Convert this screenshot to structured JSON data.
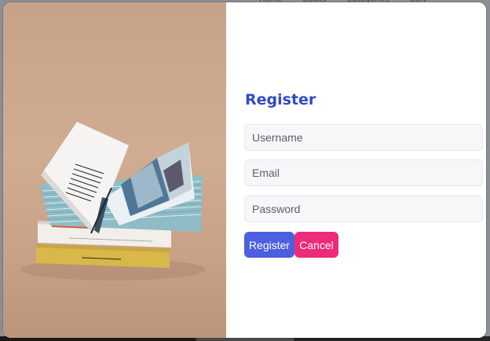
{
  "background_nav": {
    "items": [
      "Home",
      "Books",
      "Categories",
      "Cart"
    ]
  },
  "modal": {
    "image": {
      "icon": "open-book-stack-photo"
    },
    "form": {
      "title": "Register",
      "username": {
        "value": "",
        "placeholder": "Username"
      },
      "email": {
        "value": "",
        "placeholder": "Email"
      },
      "password": {
        "value": "",
        "placeholder": "Password"
      },
      "register_label": "Register",
      "cancel_label": "Cancel"
    }
  },
  "colors": {
    "title": "#2f49c9",
    "register_button": "#4b5fe0",
    "cancel_button": "#ee2a7b",
    "field_background": "#f6f7f9",
    "image_background": "#c8a288"
  }
}
